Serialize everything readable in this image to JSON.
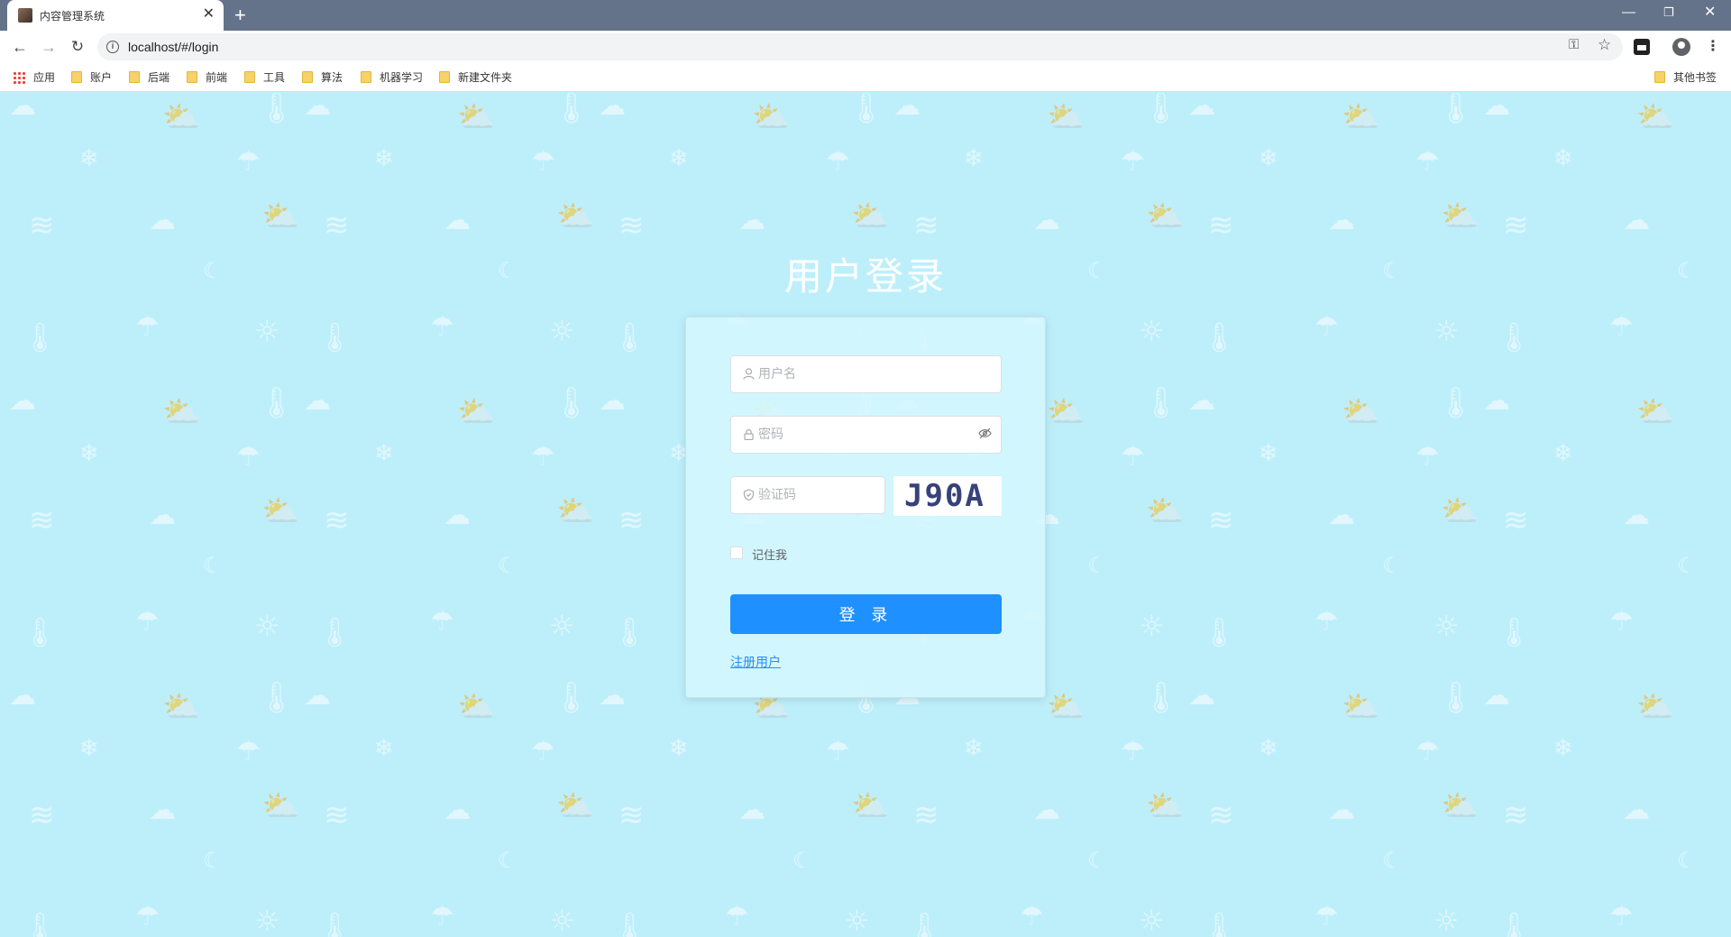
{
  "browser": {
    "tab_title": "内容管理系统",
    "tab_close": "✕",
    "new_tab": "+",
    "url": "localhost/#/login",
    "window_min": "—",
    "window_max": "❐",
    "window_close": "✕"
  },
  "bookmarks": {
    "apps": "应用",
    "items": [
      "账户",
      "后端",
      "前端",
      "工具",
      "算法",
      "机器学习",
      "新建文件夹"
    ],
    "other": "其他书签"
  },
  "login": {
    "title": "用户登录",
    "username_placeholder": "用户名",
    "password_placeholder": "密码",
    "captcha_placeholder": "验证码",
    "captcha_text": "J90A",
    "remember_label": "记住我",
    "login_button": "登 录",
    "register_link": "注册用户"
  },
  "colors": {
    "page_background": "#bdeffb",
    "primary": "#1e90ff",
    "titlebar": "#647389"
  },
  "icons": {
    "background_pattern": [
      "cloud-icon",
      "sun-cloud-icon",
      "thermometer-icon",
      "moon-icon",
      "sun-icon",
      "rain-icon",
      "snow-icon",
      "wind-icon"
    ]
  }
}
